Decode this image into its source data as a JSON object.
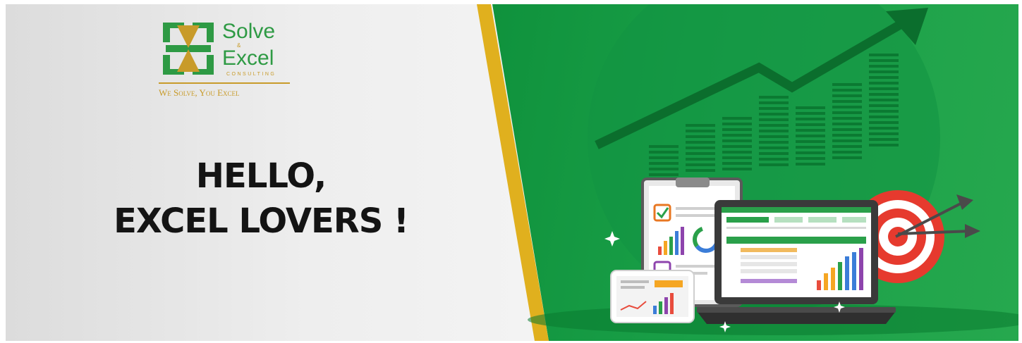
{
  "logo": {
    "line1": "Solve",
    "ampersand": "&",
    "line2": "Excel",
    "subtitle": "CONSULTING",
    "tagline": "We Solve, You Excel",
    "colors": {
      "green": "#2e9a44",
      "gold": "#c89b2a"
    }
  },
  "headline": {
    "line1": "HELLO,",
    "line2": "EXCEL LOVERS !"
  },
  "illustration": {
    "icons": [
      "trend-arrow-icon",
      "bar-chart-icon",
      "clipboard-icon",
      "laptop-icon",
      "tablet-icon",
      "target-icon",
      "sparkle-icon"
    ]
  },
  "colors": {
    "green_panel": "#0d8f3a",
    "gold_stripe": "#e0b01e",
    "left_panel": "#eeeeee",
    "headline_text": "#141414"
  }
}
